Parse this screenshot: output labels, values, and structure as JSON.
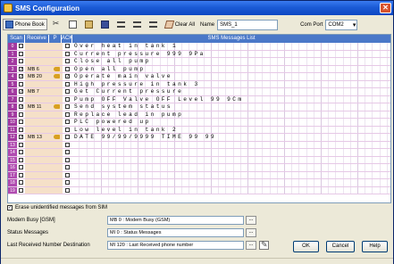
{
  "window": {
    "title": "SMS Configuration",
    "close_glyph": "✕"
  },
  "toolbar": {
    "phone_book_label": "Phone Book",
    "clear_all_label": "Clear All",
    "name_label": "Name",
    "name_value": "SMS_1",
    "com_port_label": "Com Port",
    "com_port_value": "COM2"
  },
  "grid": {
    "headers": {
      "scan": "Scan",
      "receive": "Receive",
      "p": "P",
      "ack": "ACK",
      "messages": "SMS Messages List"
    },
    "rows": [
      {
        "num": "0",
        "check": false,
        "mb": "",
        "key": false,
        "ack": false,
        "msg": "Over heat in tank 1"
      },
      {
        "num": "1",
        "check": false,
        "mb": "",
        "key": false,
        "ack": false,
        "msg": "Current pressure 999 9Pa"
      },
      {
        "num": "2",
        "check": false,
        "mb": "",
        "key": false,
        "ack": false,
        "msg": "Close all pump"
      },
      {
        "num": "3",
        "check": true,
        "mb": "MB 6",
        "key": true,
        "ack": false,
        "msg": "Open all pump"
      },
      {
        "num": "4",
        "check": true,
        "mb": "MB 20",
        "key": true,
        "ack": true,
        "msg": "Operate main valve"
      },
      {
        "num": "5",
        "check": false,
        "mb": "",
        "key": false,
        "ack": false,
        "msg": "High pressure in tank 3"
      },
      {
        "num": "6",
        "check": true,
        "mb": "MB 7",
        "key": false,
        "ack": false,
        "msg": "Get Current pressure"
      },
      {
        "num": "7",
        "check": false,
        "mb": "",
        "key": false,
        "ack": false,
        "msg": "Pump OFF Valve OFF Level 99 9Cm"
      },
      {
        "num": "8",
        "check": true,
        "mb": "MB 11",
        "key": true,
        "ack": false,
        "msg": "Send system status"
      },
      {
        "num": "9",
        "check": false,
        "mb": "",
        "key": false,
        "ack": false,
        "msg": "Replace lead in pump"
      },
      {
        "num": "10",
        "check": false,
        "mb": "",
        "key": false,
        "ack": false,
        "msg": "PLC powered up"
      },
      {
        "num": "11",
        "check": false,
        "mb": "",
        "key": false,
        "ack": false,
        "msg": "Low level in tank 2"
      },
      {
        "num": "12",
        "check": true,
        "mb": "MB 13",
        "key": true,
        "ack": false,
        "msg": "DATE 99/99/9999 TIME 99 99"
      },
      {
        "num": "13",
        "check": false,
        "mb": "",
        "key": false,
        "ack": false,
        "msg": ""
      },
      {
        "num": "14",
        "check": false,
        "mb": "",
        "key": false,
        "ack": false,
        "msg": ""
      },
      {
        "num": "15",
        "check": false,
        "mb": "",
        "key": false,
        "ack": false,
        "msg": ""
      },
      {
        "num": "16",
        "check": false,
        "mb": "",
        "key": false,
        "ack": false,
        "msg": ""
      },
      {
        "num": "17",
        "check": false,
        "mb": "",
        "key": false,
        "ack": false,
        "msg": ""
      },
      {
        "num": "18",
        "check": false,
        "mb": "",
        "key": false,
        "ack": false,
        "msg": ""
      },
      {
        "num": "19",
        "check": false,
        "mb": "",
        "key": false,
        "ack": false,
        "msg": ""
      }
    ]
  },
  "options": {
    "erase_label": "Erase unidentified messages from SIM",
    "erase_checked": true,
    "modem_busy_label": "Modem Busy [GSM]",
    "modem_busy_value": "MB 0 : Modem Busy (GSM)",
    "status_messages_label": "Status Messages",
    "status_messages_value": "MI 0 : Status Messages",
    "last_received_label": "Last Received Number Destination",
    "last_received_value": "MI 120 : Last Received phone number",
    "browse_label": "..."
  },
  "buttons": {
    "ok": "OK",
    "cancel": "Cancel",
    "help": "Help"
  },
  "colors": {
    "title_blue": "#1b5bd6",
    "row_header_purple": "#a23aa0",
    "mb_cell_peach": "#f5e0c8",
    "header_blue": "#4a78c8"
  }
}
